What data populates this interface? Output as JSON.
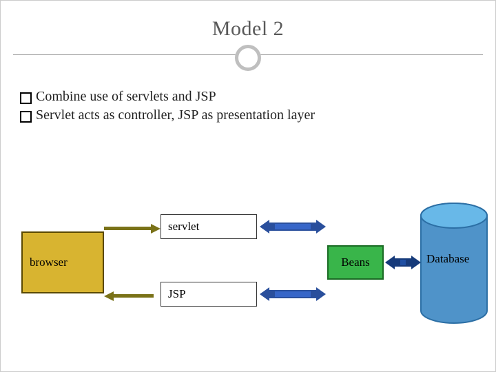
{
  "title": "Model 2",
  "bullets": [
    "Combine use of servlets and JSP",
    "Servlet acts as controller, JSP as presentation layer"
  ],
  "nodes": {
    "browser": "browser",
    "servlet": "servlet",
    "jsp": "JSP",
    "beans": "Beans",
    "database": "Database"
  },
  "colors": {
    "browser": "#d8b430",
    "beans": "#39b54a",
    "db_top": "#5aa6d6",
    "db_side": "#3f7db2"
  }
}
